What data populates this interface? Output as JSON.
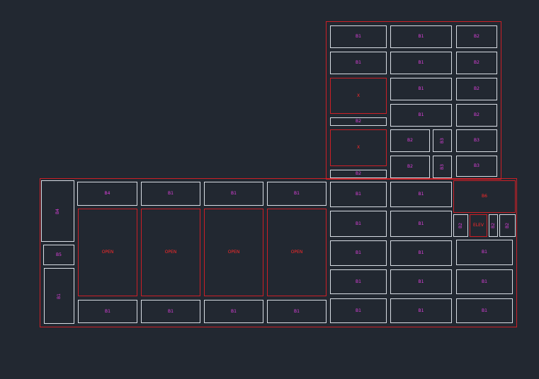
{
  "colors": {
    "background": "#222831",
    "cell_outline": "#d8dde4",
    "red_outline": "#cc1f26",
    "cell_label": "#e040e0",
    "red_label": "#ff2a2a"
  },
  "cells": [
    {
      "t": "B1"
    },
    {
      "t": "B1"
    },
    {
      "t": "B2"
    },
    {
      "t": "B1"
    },
    {
      "t": "B1"
    },
    {
      "t": "B2"
    },
    {
      "t": "X",
      "s": "red"
    },
    {
      "t": "B1"
    },
    {
      "t": "B2"
    },
    {
      "t": "B1"
    },
    {
      "t": "B2"
    },
    {
      "t": "B2"
    },
    {
      "t": "X",
      "s": "red"
    },
    {
      "t": "B2"
    },
    {
      "t": "B3"
    },
    {
      "t": "B3"
    },
    {
      "t": "B2"
    },
    {
      "t": "B2"
    },
    {
      "t": "B3"
    },
    {
      "t": "B3"
    },
    {
      "t": "B4"
    },
    {
      "t": "B5"
    },
    {
      "t": "B1"
    },
    {
      "t": "B4"
    },
    {
      "t": "B1"
    },
    {
      "t": "B1"
    },
    {
      "t": "B1"
    },
    {
      "t": "OPEN",
      "s": "red"
    },
    {
      "t": "OPEN",
      "s": "red"
    },
    {
      "t": "OPEN",
      "s": "red"
    },
    {
      "t": "OPEN",
      "s": "red"
    },
    {
      "t": "B1"
    },
    {
      "t": "B1"
    },
    {
      "t": "B1"
    },
    {
      "t": "B1"
    },
    {
      "t": "B1"
    },
    {
      "t": "B1"
    },
    {
      "t": "B6",
      "s": "red"
    },
    {
      "t": "B1"
    },
    {
      "t": "B1"
    },
    {
      "t": "B2"
    },
    {
      "t": "ELEV",
      "s": "red"
    },
    {
      "t": "B2"
    },
    {
      "t": "B2"
    },
    {
      "t": "B1"
    },
    {
      "t": "B1"
    },
    {
      "t": "B1"
    },
    {
      "t": "B1"
    },
    {
      "t": "B1"
    },
    {
      "t": "B1"
    },
    {
      "t": "B1"
    },
    {
      "t": "B1"
    },
    {
      "t": "B1"
    }
  ]
}
